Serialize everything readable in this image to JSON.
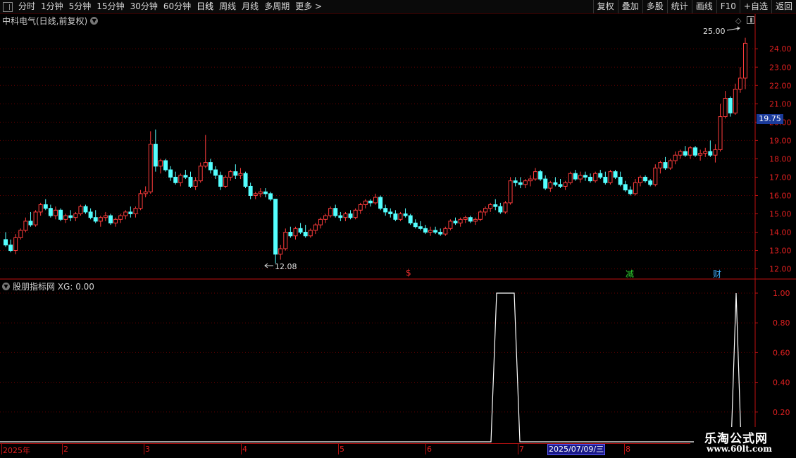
{
  "toolbar": {
    "periods": [
      "分时",
      "1分钟",
      "5分钟",
      "15分钟",
      "30分钟",
      "60分钟",
      "日线",
      "周线",
      "月线",
      "多周期",
      "更多 >"
    ],
    "active_period": "日线",
    "actions": [
      "复权",
      "叠加",
      "多股",
      "统计",
      "画线",
      "F10",
      "+自选",
      "返回"
    ]
  },
  "main_chart": {
    "title": "中科电气(日线,前复权)",
    "current_price_tag": "19.75",
    "high_annotation": "25.00",
    "low_annotation": "12.08",
    "y_axis_labels": [
      "24.00",
      "23.00",
      "22.00",
      "21.00",
      "20.00",
      "19.00",
      "18.00",
      "17.00",
      "16.00",
      "15.00",
      "14.00",
      "13.00",
      "12.00"
    ],
    "y_range": [
      11.6,
      25.2
    ],
    "markers": [
      {
        "label": "$",
        "color": "#ff3030"
      },
      {
        "label": "减",
        "color": "#30d030"
      },
      {
        "label": "财",
        "color": "#40b0ff"
      }
    ],
    "colors": {
      "up": "#ff3c3c",
      "down": "#54ffff",
      "grid": "#6a0000",
      "axis": "#c01010"
    }
  },
  "indicator": {
    "title": "股朋指标网 XG: 0.00",
    "y_axis_labels": [
      "1.00",
      "0.80",
      "0.60",
      "0.40",
      "0.20"
    ],
    "line_color": "#ffffff"
  },
  "date_axis": {
    "labels": [
      "2025年",
      "2",
      "3",
      "4",
      "5",
      "6",
      "7",
      "8"
    ],
    "cursor_date": "2025/07/09/三"
  },
  "watermark": {
    "title": "乐淘公式网",
    "url": "www.60lt.com"
  },
  "chart_data": {
    "type": "candlestick",
    "candles_ohlc": [
      [
        13.6,
        14.0,
        13.2,
        13.3
      ],
      [
        13.3,
        13.6,
        12.9,
        13.0
      ],
      [
        13.0,
        13.9,
        12.8,
        13.7
      ],
      [
        13.7,
        14.2,
        13.6,
        14.1
      ],
      [
        14.1,
        14.8,
        14.0,
        14.6
      ],
      [
        14.6,
        15.1,
        14.3,
        14.4
      ],
      [
        14.4,
        15.2,
        14.3,
        15.1
      ],
      [
        15.1,
        15.6,
        14.9,
        15.5
      ],
      [
        15.5,
        15.8,
        15.2,
        15.3
      ],
      [
        15.3,
        15.5,
        14.8,
        14.9
      ],
      [
        14.9,
        15.4,
        14.7,
        15.2
      ],
      [
        15.2,
        15.3,
        14.6,
        14.7
      ],
      [
        14.7,
        15.0,
        14.5,
        14.9
      ],
      [
        14.9,
        15.2,
        14.6,
        14.8
      ],
      [
        14.8,
        15.1,
        14.6,
        15.0
      ],
      [
        15.0,
        15.5,
        14.9,
        15.4
      ],
      [
        15.4,
        15.5,
        15.0,
        15.1
      ],
      [
        15.1,
        15.3,
        14.7,
        14.8
      ],
      [
        14.8,
        15.2,
        14.5,
        14.6
      ],
      [
        14.6,
        14.9,
        14.3,
        14.8
      ],
      [
        14.8,
        15.1,
        14.6,
        14.9
      ],
      [
        14.9,
        15.0,
        14.4,
        14.5
      ],
      [
        14.5,
        14.8,
        14.3,
        14.7
      ],
      [
        14.7,
        15.0,
        14.5,
        14.9
      ],
      [
        14.9,
        15.2,
        14.7,
        15.1
      ],
      [
        15.1,
        15.4,
        14.8,
        15.0
      ],
      [
        15.0,
        15.4,
        14.8,
        15.3
      ],
      [
        15.3,
        16.3,
        15.2,
        16.1
      ],
      [
        16.1,
        16.5,
        15.9,
        16.2
      ],
      [
        16.2,
        19.5,
        16.1,
        18.8
      ],
      [
        18.8,
        19.6,
        17.3,
        17.6
      ],
      [
        17.6,
        18.0,
        17.2,
        17.9
      ],
      [
        17.9,
        18.0,
        17.3,
        17.4
      ],
      [
        17.4,
        17.6,
        16.8,
        17.0
      ],
      [
        17.0,
        17.3,
        16.6,
        16.7
      ],
      [
        16.7,
        17.2,
        16.5,
        17.1
      ],
      [
        17.1,
        17.4,
        16.9,
        17.0
      ],
      [
        17.0,
        17.3,
        16.4,
        16.5
      ],
      [
        16.5,
        17.0,
        16.3,
        16.8
      ],
      [
        16.8,
        17.8,
        16.7,
        17.6
      ],
      [
        17.6,
        19.3,
        17.5,
        17.8
      ],
      [
        17.8,
        18.0,
        17.2,
        17.4
      ],
      [
        17.4,
        17.6,
        16.9,
        17.1
      ],
      [
        17.1,
        17.3,
        16.3,
        16.5
      ],
      [
        16.5,
        17.1,
        16.4,
        17.0
      ],
      [
        17.0,
        17.4,
        16.8,
        17.3
      ],
      [
        17.3,
        17.7,
        16.9,
        17.1
      ],
      [
        17.1,
        17.5,
        16.9,
        17.2
      ],
      [
        17.2,
        17.3,
        16.4,
        16.5
      ],
      [
        16.5,
        16.7,
        15.8,
        16.0
      ],
      [
        16.0,
        16.2,
        15.8,
        16.1
      ],
      [
        16.1,
        16.4,
        15.9,
        16.2
      ],
      [
        16.2,
        16.4,
        15.9,
        16.1
      ],
      [
        16.1,
        16.2,
        15.7,
        15.8
      ],
      [
        15.8,
        15.8,
        12.3,
        12.8
      ],
      [
        12.8,
        13.3,
        12.5,
        13.1
      ],
      [
        13.1,
        14.2,
        13.0,
        14.0
      ],
      [
        14.0,
        14.3,
        13.7,
        13.8
      ],
      [
        13.8,
        14.3,
        13.6,
        14.2
      ],
      [
        14.2,
        14.5,
        13.9,
        14.0
      ],
      [
        14.0,
        14.4,
        13.7,
        13.8
      ],
      [
        13.8,
        14.2,
        13.7,
        14.1
      ],
      [
        14.1,
        14.5,
        13.9,
        14.4
      ],
      [
        14.4,
        14.8,
        14.2,
        14.7
      ],
      [
        14.7,
        15.0,
        14.5,
        14.9
      ],
      [
        14.9,
        15.4,
        14.8,
        15.3
      ],
      [
        15.3,
        15.5,
        14.8,
        14.9
      ],
      [
        14.9,
        15.1,
        14.6,
        14.8
      ],
      [
        14.8,
        15.1,
        14.6,
        15.0
      ],
      [
        15.0,
        15.2,
        14.7,
        14.8
      ],
      [
        14.8,
        15.3,
        14.7,
        15.2
      ],
      [
        15.2,
        15.6,
        15.0,
        15.5
      ],
      [
        15.5,
        15.8,
        15.3,
        15.7
      ],
      [
        15.7,
        15.8,
        15.4,
        15.6
      ],
      [
        15.6,
        16.1,
        15.5,
        15.9
      ],
      [
        15.9,
        16.0,
        15.2,
        15.3
      ],
      [
        15.3,
        15.5,
        14.9,
        15.1
      ],
      [
        15.1,
        15.3,
        14.8,
        15.0
      ],
      [
        15.0,
        15.2,
        14.6,
        14.7
      ],
      [
        14.7,
        15.1,
        14.6,
        15.0
      ],
      [
        15.0,
        15.3,
        14.8,
        14.9
      ],
      [
        14.9,
        15.0,
        14.4,
        14.5
      ],
      [
        14.5,
        14.7,
        14.2,
        14.3
      ],
      [
        14.3,
        14.6,
        14.1,
        14.2
      ],
      [
        14.2,
        14.4,
        13.9,
        14.0
      ],
      [
        14.0,
        14.3,
        13.8,
        14.1
      ],
      [
        14.1,
        14.3,
        13.9,
        14.0
      ],
      [
        14.0,
        14.2,
        13.8,
        13.9
      ],
      [
        13.9,
        14.3,
        13.8,
        14.2
      ],
      [
        14.2,
        14.7,
        14.1,
        14.6
      ],
      [
        14.6,
        14.8,
        14.4,
        14.5
      ],
      [
        14.5,
        14.8,
        14.3,
        14.7
      ],
      [
        14.7,
        14.9,
        14.5,
        14.8
      ],
      [
        14.8,
        14.9,
        14.5,
        14.6
      ],
      [
        14.6,
        14.8,
        14.4,
        14.7
      ],
      [
        14.7,
        15.2,
        14.6,
        15.1
      ],
      [
        15.1,
        15.4,
        14.9,
        15.3
      ],
      [
        15.3,
        15.6,
        15.1,
        15.5
      ],
      [
        15.5,
        15.8,
        15.2,
        15.4
      ],
      [
        15.4,
        15.6,
        15.0,
        15.1
      ],
      [
        15.1,
        15.7,
        15.0,
        15.6
      ],
      [
        15.6,
        17.0,
        15.5,
        16.8
      ],
      [
        16.8,
        17.0,
        16.5,
        16.7
      ],
      [
        16.7,
        17.0,
        16.4,
        16.6
      ],
      [
        16.6,
        16.9,
        16.4,
        16.8
      ],
      [
        16.8,
        17.1,
        16.5,
        16.9
      ],
      [
        16.9,
        17.5,
        16.8,
        17.3
      ],
      [
        17.3,
        17.4,
        16.8,
        16.9
      ],
      [
        16.9,
        17.1,
        16.3,
        16.4
      ],
      [
        16.4,
        16.8,
        16.2,
        16.7
      ],
      [
        16.7,
        17.0,
        16.5,
        16.6
      ],
      [
        16.6,
        16.9,
        16.4,
        16.5
      ],
      [
        16.5,
        16.8,
        16.3,
        16.7
      ],
      [
        16.7,
        17.3,
        16.6,
        17.2
      ],
      [
        17.2,
        17.4,
        16.8,
        16.9
      ],
      [
        16.9,
        17.3,
        16.7,
        17.1
      ],
      [
        17.1,
        17.3,
        16.8,
        17.0
      ],
      [
        17.0,
        17.2,
        16.7,
        16.8
      ],
      [
        16.8,
        17.3,
        16.7,
        17.2
      ],
      [
        17.2,
        17.4,
        16.9,
        17.0
      ],
      [
        17.0,
        17.3,
        16.6,
        16.7
      ],
      [
        16.7,
        17.4,
        16.6,
        17.3
      ],
      [
        17.3,
        17.4,
        16.9,
        17.0
      ],
      [
        17.0,
        17.3,
        16.5,
        16.6
      ],
      [
        16.6,
        16.8,
        16.2,
        16.3
      ],
      [
        16.3,
        16.5,
        16.0,
        16.1
      ],
      [
        16.1,
        16.9,
        16.0,
        16.7
      ],
      [
        16.7,
        17.1,
        16.5,
        17.0
      ],
      [
        17.0,
        17.1,
        16.7,
        16.8
      ],
      [
        16.8,
        16.9,
        16.5,
        16.6
      ],
      [
        16.6,
        17.7,
        16.5,
        17.5
      ],
      [
        17.5,
        17.9,
        17.2,
        17.8
      ],
      [
        17.8,
        18.1,
        17.4,
        17.5
      ],
      [
        17.5,
        18.0,
        17.4,
        17.9
      ],
      [
        17.9,
        18.4,
        17.7,
        18.2
      ],
      [
        18.2,
        18.5,
        18.0,
        18.4
      ],
      [
        18.4,
        18.7,
        18.1,
        18.2
      ],
      [
        18.2,
        18.7,
        18.0,
        18.6
      ],
      [
        18.6,
        18.7,
        18.1,
        18.2
      ],
      [
        18.2,
        18.5,
        17.9,
        18.3
      ],
      [
        18.3,
        18.6,
        18.1,
        18.4
      ],
      [
        18.4,
        19.0,
        18.1,
        18.2
      ],
      [
        18.2,
        18.8,
        17.8,
        18.5
      ],
      [
        18.5,
        21.0,
        18.4,
        20.3
      ],
      [
        20.3,
        21.7,
        20.2,
        21.3
      ],
      [
        21.3,
        21.4,
        20.3,
        20.5
      ],
      [
        20.5,
        22.1,
        20.4,
        21.8
      ],
      [
        21.8,
        23.0,
        21.6,
        22.4
      ],
      [
        22.4,
        24.6,
        21.8,
        24.3
      ]
    ],
    "indicator_xg_series_note": "XG signal is 0 except two spikes at 1.00 (around early July and at the last bars)"
  }
}
